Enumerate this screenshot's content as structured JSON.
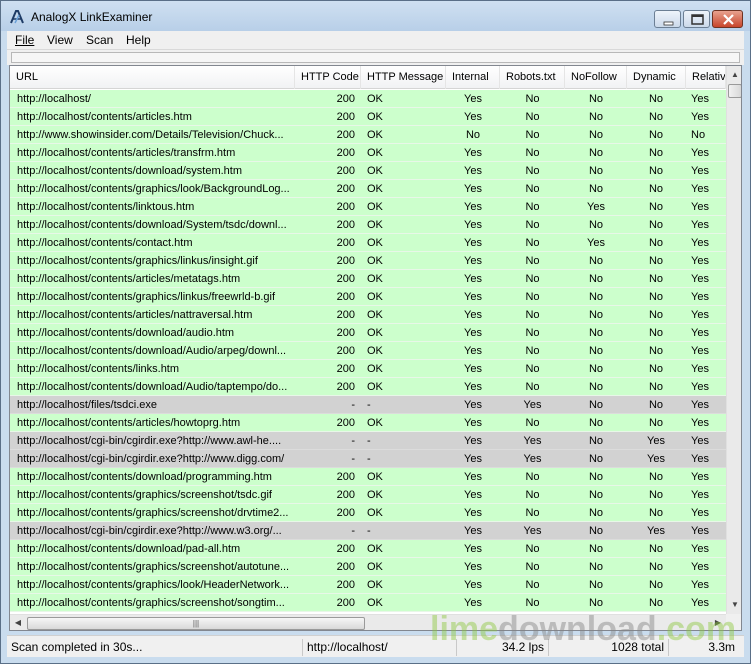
{
  "window": {
    "title": "AnalogX LinkExaminer",
    "colors": {
      "ok_row": "#ccffcc",
      "skipped_row": "#d2d2d2"
    }
  },
  "menu": [
    "File",
    "View",
    "Scan",
    "Help"
  ],
  "columns": [
    "URL",
    "HTTP Code",
    "HTTP Message",
    "Internal",
    "Robots.txt",
    "NoFollow",
    "Dynamic",
    "Relativ"
  ],
  "rows": [
    {
      "url": "http://localhost/",
      "code": "200",
      "msg": "OK",
      "internal": "Yes",
      "robots": "No",
      "nofollow": "No",
      "dynamic": "No",
      "relative": "Yes",
      "status": "ok"
    },
    {
      "url": "http://localhost/contents/articles.htm",
      "code": "200",
      "msg": "OK",
      "internal": "Yes",
      "robots": "No",
      "nofollow": "No",
      "dynamic": "No",
      "relative": "Yes",
      "status": "ok"
    },
    {
      "url": "http://www.showinsider.com/Details/Television/Chuck...",
      "code": "200",
      "msg": "OK",
      "internal": "No",
      "robots": "No",
      "nofollow": "No",
      "dynamic": "No",
      "relative": "No",
      "status": "ok"
    },
    {
      "url": "http://localhost/contents/articles/transfrm.htm",
      "code": "200",
      "msg": "OK",
      "internal": "Yes",
      "robots": "No",
      "nofollow": "No",
      "dynamic": "No",
      "relative": "Yes",
      "status": "ok"
    },
    {
      "url": "http://localhost/contents/download/system.htm",
      "code": "200",
      "msg": "OK",
      "internal": "Yes",
      "robots": "No",
      "nofollow": "No",
      "dynamic": "No",
      "relative": "Yes",
      "status": "ok"
    },
    {
      "url": "http://localhost/contents/graphics/look/BackgroundLog...",
      "code": "200",
      "msg": "OK",
      "internal": "Yes",
      "robots": "No",
      "nofollow": "No",
      "dynamic": "No",
      "relative": "Yes",
      "status": "ok"
    },
    {
      "url": "http://localhost/contents/linktous.htm",
      "code": "200",
      "msg": "OK",
      "internal": "Yes",
      "robots": "No",
      "nofollow": "Yes",
      "dynamic": "No",
      "relative": "Yes",
      "status": "ok"
    },
    {
      "url": "http://localhost/contents/download/System/tsdc/downl...",
      "code": "200",
      "msg": "OK",
      "internal": "Yes",
      "robots": "No",
      "nofollow": "No",
      "dynamic": "No",
      "relative": "Yes",
      "status": "ok"
    },
    {
      "url": "http://localhost/contents/contact.htm",
      "code": "200",
      "msg": "OK",
      "internal": "Yes",
      "robots": "No",
      "nofollow": "Yes",
      "dynamic": "No",
      "relative": "Yes",
      "status": "ok"
    },
    {
      "url": "http://localhost/contents/graphics/linkus/insight.gif",
      "code": "200",
      "msg": "OK",
      "internal": "Yes",
      "robots": "No",
      "nofollow": "No",
      "dynamic": "No",
      "relative": "Yes",
      "status": "ok"
    },
    {
      "url": "http://localhost/contents/articles/metatags.htm",
      "code": "200",
      "msg": "OK",
      "internal": "Yes",
      "robots": "No",
      "nofollow": "No",
      "dynamic": "No",
      "relative": "Yes",
      "status": "ok"
    },
    {
      "url": "http://localhost/contents/graphics/linkus/freewrld-b.gif",
      "code": "200",
      "msg": "OK",
      "internal": "Yes",
      "robots": "No",
      "nofollow": "No",
      "dynamic": "No",
      "relative": "Yes",
      "status": "ok"
    },
    {
      "url": "http://localhost/contents/articles/nattraversal.htm",
      "code": "200",
      "msg": "OK",
      "internal": "Yes",
      "robots": "No",
      "nofollow": "No",
      "dynamic": "No",
      "relative": "Yes",
      "status": "ok"
    },
    {
      "url": "http://localhost/contents/download/audio.htm",
      "code": "200",
      "msg": "OK",
      "internal": "Yes",
      "robots": "No",
      "nofollow": "No",
      "dynamic": "No",
      "relative": "Yes",
      "status": "ok"
    },
    {
      "url": "http://localhost/contents/download/Audio/arpeg/downl...",
      "code": "200",
      "msg": "OK",
      "internal": "Yes",
      "robots": "No",
      "nofollow": "No",
      "dynamic": "No",
      "relative": "Yes",
      "status": "ok"
    },
    {
      "url": "http://localhost/contents/links.htm",
      "code": "200",
      "msg": "OK",
      "internal": "Yes",
      "robots": "No",
      "nofollow": "No",
      "dynamic": "No",
      "relative": "Yes",
      "status": "ok"
    },
    {
      "url": "http://localhost/contents/download/Audio/taptempo/do...",
      "code": "200",
      "msg": "OK",
      "internal": "Yes",
      "robots": "No",
      "nofollow": "No",
      "dynamic": "No",
      "relative": "Yes",
      "status": "ok"
    },
    {
      "url": "http://localhost/files/tsdci.exe",
      "code": "-",
      "msg": "-",
      "internal": "Yes",
      "robots": "Yes",
      "nofollow": "No",
      "dynamic": "No",
      "relative": "Yes",
      "status": "grey"
    },
    {
      "url": "http://localhost/contents/articles/howtoprg.htm",
      "code": "200",
      "msg": "OK",
      "internal": "Yes",
      "robots": "No",
      "nofollow": "No",
      "dynamic": "No",
      "relative": "Yes",
      "status": "ok"
    },
    {
      "url": "http://localhost/cgi-bin/cgirdir.exe?http://www.awl-he....",
      "code": "-",
      "msg": "-",
      "internal": "Yes",
      "robots": "Yes",
      "nofollow": "No",
      "dynamic": "Yes",
      "relative": "Yes",
      "status": "grey"
    },
    {
      "url": "http://localhost/cgi-bin/cgirdir.exe?http://www.digg.com/",
      "code": "-",
      "msg": "-",
      "internal": "Yes",
      "robots": "Yes",
      "nofollow": "No",
      "dynamic": "Yes",
      "relative": "Yes",
      "status": "grey"
    },
    {
      "url": "http://localhost/contents/download/programming.htm",
      "code": "200",
      "msg": "OK",
      "internal": "Yes",
      "robots": "No",
      "nofollow": "No",
      "dynamic": "No",
      "relative": "Yes",
      "status": "ok"
    },
    {
      "url": "http://localhost/contents/graphics/screenshot/tsdc.gif",
      "code": "200",
      "msg": "OK",
      "internal": "Yes",
      "robots": "No",
      "nofollow": "No",
      "dynamic": "No",
      "relative": "Yes",
      "status": "ok"
    },
    {
      "url": "http://localhost/contents/graphics/screenshot/drvtime2...",
      "code": "200",
      "msg": "OK",
      "internal": "Yes",
      "robots": "No",
      "nofollow": "No",
      "dynamic": "No",
      "relative": "Yes",
      "status": "ok"
    },
    {
      "url": "http://localhost/cgi-bin/cgirdir.exe?http://www.w3.org/...",
      "code": "-",
      "msg": "-",
      "internal": "Yes",
      "robots": "Yes",
      "nofollow": "No",
      "dynamic": "Yes",
      "relative": "Yes",
      "status": "grey"
    },
    {
      "url": "http://localhost/contents/download/pad-all.htm",
      "code": "200",
      "msg": "OK",
      "internal": "Yes",
      "robots": "No",
      "nofollow": "No",
      "dynamic": "No",
      "relative": "Yes",
      "status": "ok"
    },
    {
      "url": "http://localhost/contents/graphics/screenshot/autotune...",
      "code": "200",
      "msg": "OK",
      "internal": "Yes",
      "robots": "No",
      "nofollow": "No",
      "dynamic": "No",
      "relative": "Yes",
      "status": "ok"
    },
    {
      "url": "http://localhost/contents/graphics/look/HeaderNetwork...",
      "code": "200",
      "msg": "OK",
      "internal": "Yes",
      "robots": "No",
      "nofollow": "No",
      "dynamic": "No",
      "relative": "Yes",
      "status": "ok"
    },
    {
      "url": "http://localhost/contents/graphics/screenshot/songtim...",
      "code": "200",
      "msg": "OK",
      "internal": "Yes",
      "robots": "No",
      "nofollow": "No",
      "dynamic": "No",
      "relative": "Yes",
      "status": "ok"
    }
  ],
  "status": {
    "message": "Scan completed in 30s...",
    "url": "http://localhost/",
    "rate": "34.2 lps",
    "total": "1028 total",
    "size": "3.3m"
  },
  "watermark": {
    "part1": "lime",
    "part2": "download",
    "part3": ".com"
  }
}
